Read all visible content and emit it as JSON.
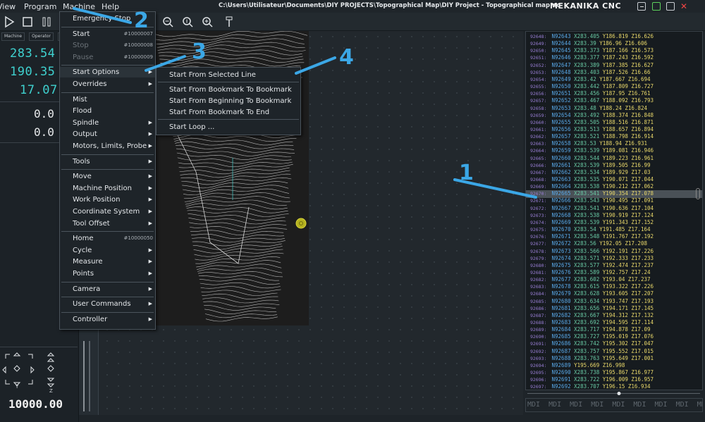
{
  "menubar": {
    "items": [
      "View",
      "Program",
      "Machine",
      "Help"
    ],
    "title": "C:\\Users\\Utilisateur\\Documents\\DIY PROJECTS\\Topographical Map\\DIY Project - Topographical map.nc",
    "brand": "MEKANIKA CNC"
  },
  "dro": {
    "tabs": [
      "Machine",
      "Operator",
      "G"
    ],
    "x": "283.54",
    "y": "190.35",
    "z": "17.07",
    "a": "0.0",
    "b": "0.0"
  },
  "feed": "10000.00",
  "jog": {
    "y_label": "Y",
    "z_label": "Z"
  },
  "machine_menu": [
    {
      "label": "Emergency Stop",
      "shortcut": "",
      "arrow": false,
      "disabled": false
    },
    {
      "label": "Start",
      "shortcut": "#10000007",
      "arrow": false,
      "disabled": false
    },
    {
      "label": "Stop",
      "shortcut": "#10000008",
      "arrow": false,
      "disabled": true
    },
    {
      "label": "Pause",
      "shortcut": "#10000009",
      "arrow": false,
      "disabled": true
    },
    {
      "label": "Start Options",
      "shortcut": "",
      "arrow": true,
      "disabled": false
    },
    {
      "label": "Overrides",
      "shortcut": "",
      "arrow": true,
      "disabled": false
    },
    {
      "label": "Mist",
      "shortcut": "",
      "arrow": false,
      "disabled": false
    },
    {
      "label": "Flood",
      "shortcut": "",
      "arrow": false,
      "disabled": false
    },
    {
      "label": "Spindle",
      "shortcut": "",
      "arrow": true,
      "disabled": false
    },
    {
      "label": "Output",
      "shortcut": "",
      "arrow": true,
      "disabled": false
    },
    {
      "label": "Motors, Limits, Probe",
      "shortcut": "",
      "arrow": true,
      "disabled": false
    },
    {
      "label": "Tools",
      "shortcut": "",
      "arrow": true,
      "disabled": false
    },
    {
      "label": "Move",
      "shortcut": "",
      "arrow": true,
      "disabled": false
    },
    {
      "label": "Machine Position",
      "shortcut": "",
      "arrow": true,
      "disabled": false
    },
    {
      "label": "Work Position",
      "shortcut": "",
      "arrow": true,
      "disabled": false
    },
    {
      "label": "Coordinate System",
      "shortcut": "",
      "arrow": true,
      "disabled": false
    },
    {
      "label": "Tool Offset",
      "shortcut": "",
      "arrow": true,
      "disabled": false
    },
    {
      "label": "Home",
      "shortcut": "#10000050",
      "arrow": false,
      "disabled": false
    },
    {
      "label": "Cycle",
      "shortcut": "",
      "arrow": true,
      "disabled": false
    },
    {
      "label": "Measure",
      "shortcut": "",
      "arrow": true,
      "disabled": false
    },
    {
      "label": "Points",
      "shortcut": "",
      "arrow": true,
      "disabled": false
    },
    {
      "label": "Camera",
      "shortcut": "",
      "arrow": true,
      "disabled": false
    },
    {
      "label": "User Commands",
      "shortcut": "",
      "arrow": true,
      "disabled": false
    },
    {
      "label": "Controller",
      "shortcut": "",
      "arrow": true,
      "disabled": false
    }
  ],
  "start_options_menu": [
    "Start From Selected Line",
    "Start From Bookmark To Bookmark",
    "Start From Beginning To Bookmark",
    "Start From Bookmark To End",
    "Start Loop ..."
  ],
  "annotations": [
    "1",
    "2",
    "3",
    "4"
  ],
  "gcode": [
    [
      "92648:",
      "N92643",
      "X283.405",
      "Y186.819",
      "Z16.626"
    ],
    [
      "92649:",
      "N92644",
      "X283.39",
      "Y186.96",
      "Z16.606"
    ],
    [
      "92650:",
      "N92645",
      "X283.373",
      "Y187.166",
      "Z16.573"
    ],
    [
      "92651:",
      "N92646",
      "X283.377",
      "Y187.243",
      "Z16.592"
    ],
    [
      "92652:",
      "N92647",
      "X283.389",
      "Y187.385",
      "Z16.627"
    ],
    [
      "92653:",
      "N92648",
      "X283.403",
      "Y187.526",
      "Z16.66"
    ],
    [
      "92654:",
      "N92649",
      "X283.42",
      "Y187.667",
      "Z16.694"
    ],
    [
      "92655:",
      "N92650",
      "X283.442",
      "Y187.809",
      "Z16.727"
    ],
    [
      "92656:",
      "N92651",
      "X283.456",
      "Y187.95",
      "Z16.761"
    ],
    [
      "92657:",
      "N92652",
      "X283.467",
      "Y188.092",
      "Z16.793"
    ],
    [
      "92658:",
      "N92653",
      "X283.48",
      "Y188.24",
      "Z16.824"
    ],
    [
      "92659:",
      "N92654",
      "X283.492",
      "Y188.374",
      "Z16.848"
    ],
    [
      "92660:",
      "N92655",
      "X283.505",
      "Y188.516",
      "Z16.871"
    ],
    [
      "92661:",
      "N92656",
      "X283.513",
      "Y188.657",
      "Z16.894"
    ],
    [
      "92662:",
      "N92657",
      "X283.521",
      "Y188.798",
      "Z16.914"
    ],
    [
      "92663:",
      "N92658",
      "X283.53",
      "Y188.94",
      "Z16.931"
    ],
    [
      "92664:",
      "N92659",
      "X283.539",
      "Y189.081",
      "Z16.946"
    ],
    [
      "92665:",
      "N92660",
      "X283.544",
      "Y189.223",
      "Z16.961"
    ],
    [
      "92666:",
      "N92661",
      "X283.539",
      "Y189.505",
      "Z16.99"
    ],
    [
      "92667:",
      "N92662",
      "X283.534",
      "Y189.929",
      "Z17.03"
    ],
    [
      "92668:",
      "N92663",
      "X283.535",
      "Y190.071",
      "Z17.044"
    ],
    [
      "92669:",
      "N92664",
      "X283.538",
      "Y190.212",
      "Z17.062"
    ],
    [
      "92670:",
      "N92665",
      "X283.541",
      "Y190.354",
      "Z17.078"
    ],
    [
      "92671:",
      "N92666",
      "X283.543",
      "Y190.495",
      "Z17.091"
    ],
    [
      "92672:",
      "N92667",
      "X283.541",
      "Y190.636",
      "Z17.104"
    ],
    [
      "92673:",
      "N92668",
      "X283.538",
      "Y190.919",
      "Z17.124"
    ],
    [
      "92674:",
      "N92669",
      "X283.539",
      "Y191.343",
      "Z17.152"
    ],
    [
      "92675:",
      "N92670",
      "X283.54",
      "Y191.485",
      "Z17.164"
    ],
    [
      "92676:",
      "N92671",
      "X283.548",
      "Y191.767",
      "Z17.192"
    ],
    [
      "92677:",
      "N92672",
      "X283.56",
      "Y192.05",
      "Z17.208"
    ],
    [
      "92678:",
      "N92673",
      "X283.566",
      "Y192.191",
      "Z17.226"
    ],
    [
      "92679:",
      "N92674",
      "X283.571",
      "Y192.333",
      "Z17.233"
    ],
    [
      "92680:",
      "N92675",
      "X283.577",
      "Y192.474",
      "Z17.237"
    ],
    [
      "92681:",
      "N92676",
      "X283.589",
      "Y192.757",
      "Z17.24"
    ],
    [
      "92682:",
      "N92677",
      "X283.602",
      "Y193.04",
      "Z17.237"
    ],
    [
      "92683:",
      "N92678",
      "X283.615",
      "Y193.322",
      "Z17.226"
    ],
    [
      "92684:",
      "N92679",
      "X283.628",
      "Y193.605",
      "Z17.207"
    ],
    [
      "92685:",
      "N92680",
      "X283.634",
      "Y193.747",
      "Z17.193"
    ],
    [
      "92686:",
      "N92681",
      "X283.656",
      "Y194.171",
      "Z17.145"
    ],
    [
      "92687:",
      "N92682",
      "X283.667",
      "Y194.312",
      "Z17.132"
    ],
    [
      "92688:",
      "N92683",
      "X283.692",
      "Y194.595",
      "Z17.114"
    ],
    [
      "92689:",
      "N92684",
      "X283.717",
      "Y194.878",
      "Z17.09"
    ],
    [
      "92690:",
      "N92685",
      "X283.727",
      "Y195.019",
      "Z17.076"
    ],
    [
      "92691:",
      "N92686",
      "X283.742",
      "Y195.302",
      "Z17.047"
    ],
    [
      "92692:",
      "N92687",
      "X283.757",
      "Y195.552",
      "Z17.015"
    ],
    [
      "92693:",
      "N92688",
      "X283.763",
      "Y195.649",
      "Z17.001"
    ],
    [
      "92694:",
      "N92689",
      "",
      "Y195.669",
      "Z16.998"
    ],
    [
      "92695:",
      "N92690",
      "X283.738",
      "Y195.867",
      "Z16.977"
    ],
    [
      "92696:",
      "N92691",
      "X283.722",
      "Y196.009",
      "Z16.957"
    ],
    [
      "92697:",
      "N92692",
      "X283.707",
      "Y196.15",
      "Z16.934"
    ]
  ],
  "gcode_current_line": "92670:",
  "mdi": "MDI MDI MDI MDI MDI MDI MDI MDI MDI MDI"
}
